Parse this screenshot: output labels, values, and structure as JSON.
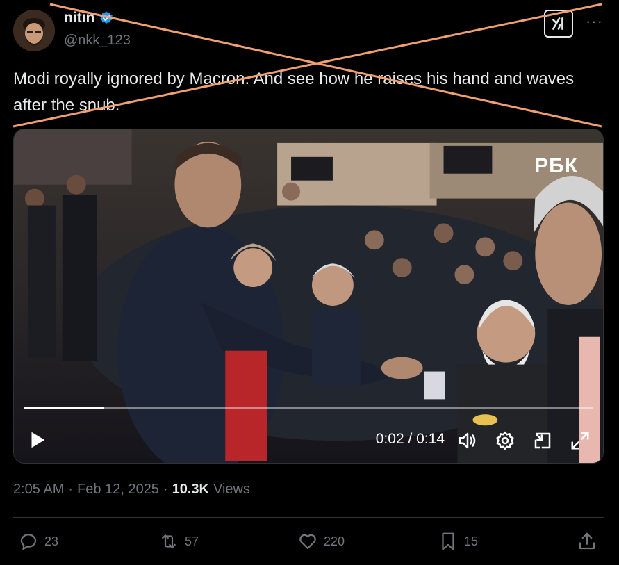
{
  "author": {
    "display_name": "nitin",
    "handle": "@nkk_123",
    "verified": true
  },
  "tweet": {
    "text": "Modi royally ignored by Macron. And see how he raises his hand and waves after the snub."
  },
  "video": {
    "watermark": "РБК",
    "time": "0:02 / 0:14",
    "progress_fraction": 0.14,
    "controls": [
      "play-icon",
      "volume-icon",
      "settings-icon",
      "picture-in-picture-icon",
      "fullscreen-icon"
    ]
  },
  "meta": {
    "time": "2:05 AM",
    "date": "Feb 12, 2025",
    "separator": "·",
    "views_count": "10.3K",
    "views_label": "Views"
  },
  "actions": {
    "replies": "23",
    "reposts": "57",
    "likes": "220",
    "bookmarks": "15"
  },
  "colors": {
    "background": "#000000",
    "text": "#e7e9ea",
    "muted": "#71767b",
    "verified": "#1d9bf0",
    "cross_lines": "#f0a070"
  },
  "icons": [
    "grok-icon",
    "more-icon",
    "verified-icon",
    "reply-icon",
    "repost-icon",
    "like-icon",
    "bookmark-icon",
    "share-icon"
  ]
}
